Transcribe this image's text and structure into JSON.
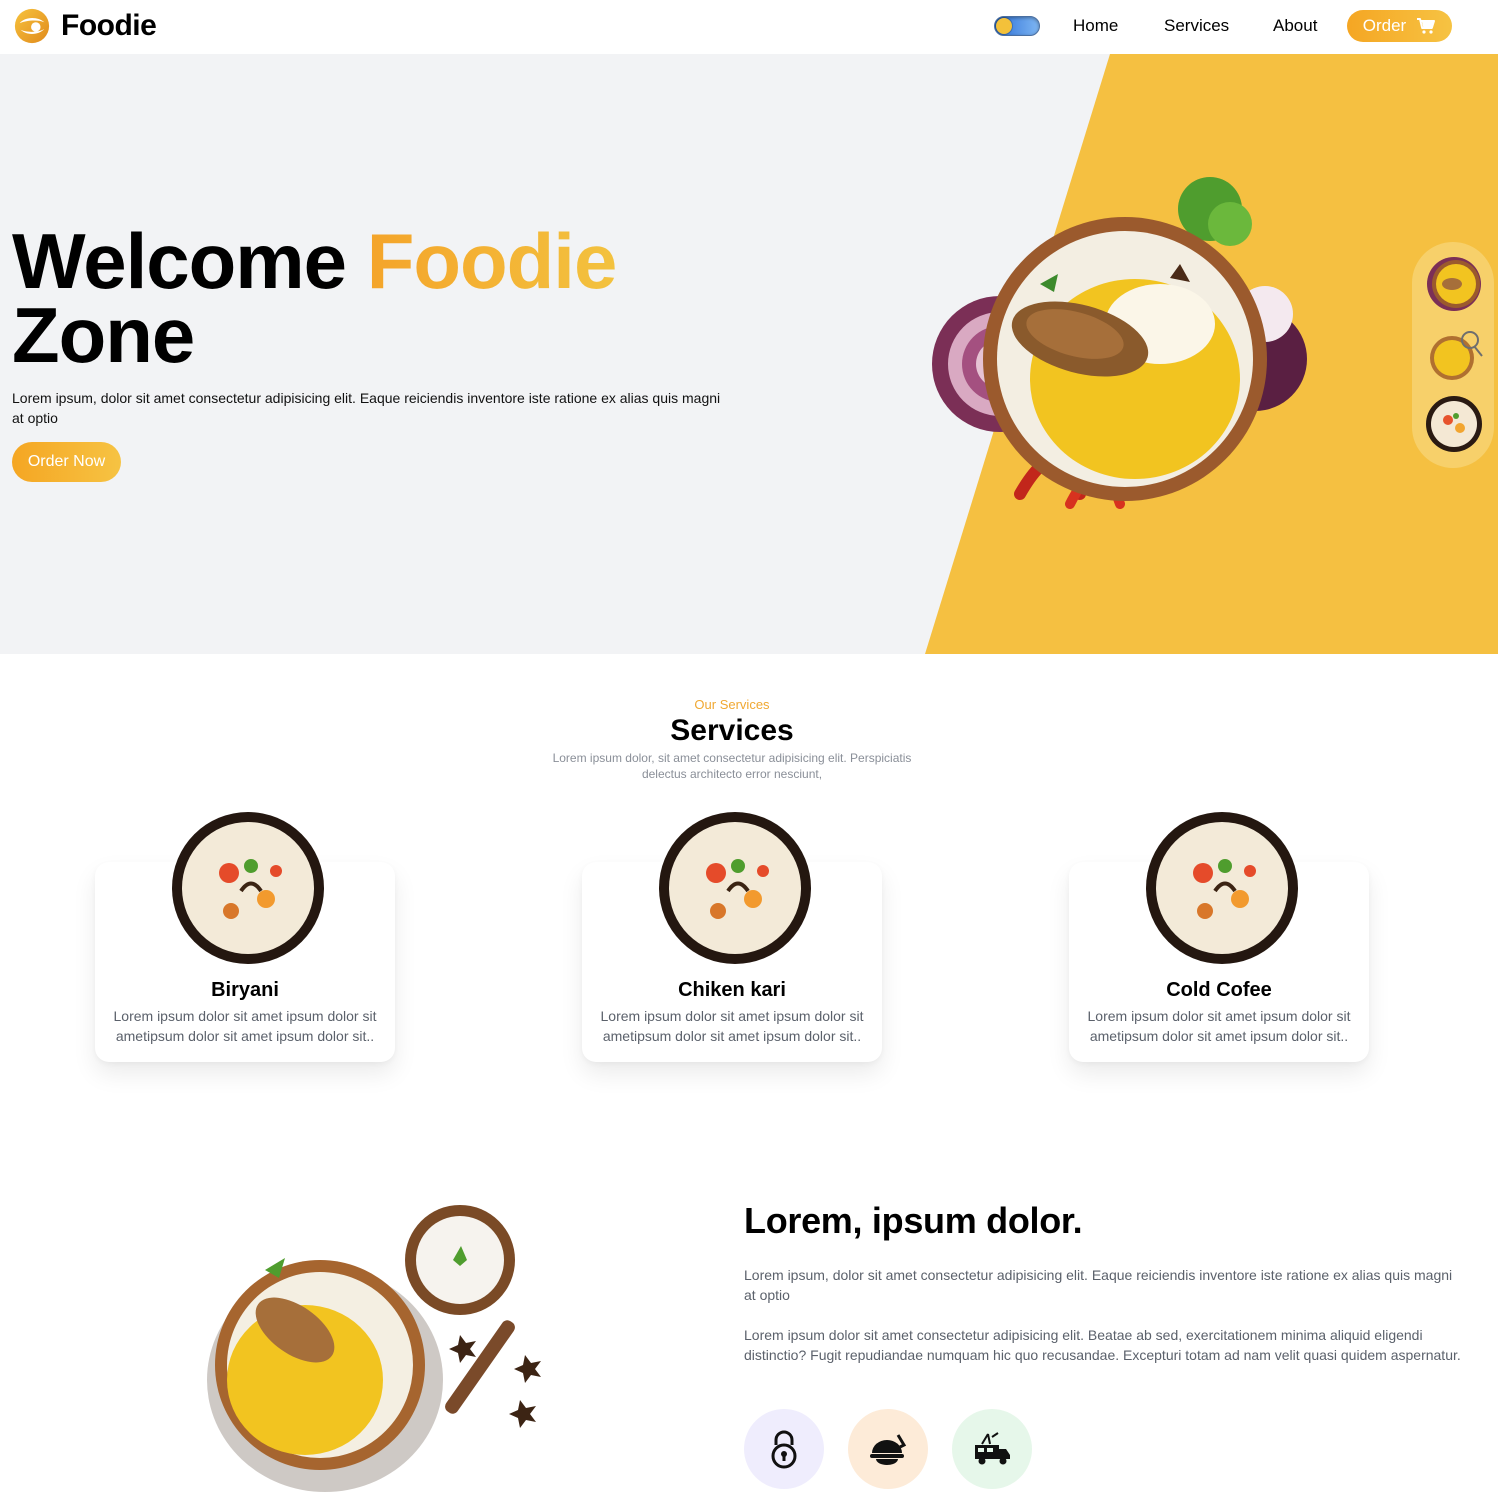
{
  "nav": {
    "brand": "Foodie",
    "links": [
      "Home",
      "Services",
      "About"
    ],
    "order_label": "Order"
  },
  "hero": {
    "title_line1_a": "Welcome",
    "title_line1_b": "Foodie",
    "title_line2": "Zone",
    "text": "Lorem ipsum, dolor sit amet consectetur adipisicing elit. Eaque reiciendis inventore iste ratione ex alias quis magni at optio",
    "cta": "Order Now"
  },
  "services": {
    "kicker": "Our Services",
    "title": "Services",
    "subtitle": "Lorem ipsum dolor, sit amet consectetur adipisicing elit. Perspiciatis delectus architecto error nesciunt,",
    "cards": [
      {
        "title": "Biryani",
        "desc": "Lorem ipsum dolor sit amet ipsum dolor sit ametipsum dolor sit amet ipsum dolor sit.."
      },
      {
        "title": "Chiken kari",
        "desc": "Lorem ipsum dolor sit amet ipsum dolor sit ametipsum dolor sit amet ipsum dolor sit.."
      },
      {
        "title": "Cold Cofee",
        "desc": "Lorem ipsum dolor sit amet ipsum dolor sit ametipsum dolor sit amet ipsum dolor sit.."
      }
    ]
  },
  "about": {
    "title": "Lorem, ipsum dolor.",
    "p1": "Lorem ipsum, dolor sit amet consectetur adipisicing elit. Eaque reiciendis inventore iste ratione ex alias quis magni at optio",
    "p2": "Lorem ipsum dolor sit amet consectetur adipisicing elit. Beatae ab sed, exercitationem minima aliquid eligendi distinctio? Fugit repudiandae numquam hic quo recusandae. Excepturi totam ad nam velit quasi quidem aspernatur.",
    "features": [
      {
        "icon": "lock-icon",
        "bg": "#efedfd"
      },
      {
        "icon": "food-delivery-icon",
        "bg": "#fdebd8"
      },
      {
        "icon": "food-truck-icon",
        "bg": "#e6f7ea"
      }
    ]
  },
  "colors": {
    "accent": "#f3a92f",
    "accent_light": "#f6c343",
    "hero_bg": "#f2f3f5",
    "hero_yellow": "#f5c041"
  }
}
